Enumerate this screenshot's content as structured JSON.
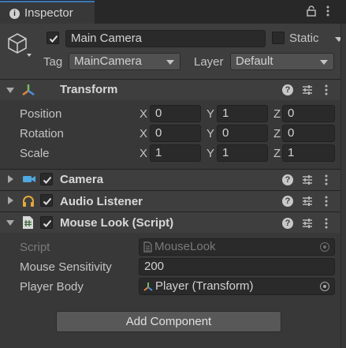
{
  "tab": {
    "label": "Inspector"
  },
  "gameobject": {
    "name": "Main Camera",
    "static_label": "Static",
    "tag_label": "Tag",
    "tag_value": "MainCamera",
    "layer_label": "Layer",
    "layer_value": "Default"
  },
  "transform": {
    "title": "Transform",
    "rows": [
      {
        "label": "Position",
        "x": "0",
        "y": "1",
        "z": "0"
      },
      {
        "label": "Rotation",
        "x": "0",
        "y": "0",
        "z": "0"
      },
      {
        "label": "Scale",
        "x": "1",
        "y": "1",
        "z": "1"
      }
    ],
    "axis": {
      "x": "X",
      "y": "Y",
      "z": "Z"
    }
  },
  "camera": {
    "title": "Camera"
  },
  "audio_listener": {
    "title": "Audio Listener"
  },
  "mouse_look": {
    "title": "Mouse Look (Script)",
    "script_label": "Script",
    "script_value": "MouseLook",
    "sensitivity_label": "Mouse Sensitivity",
    "sensitivity_value": "200",
    "player_body_label": "Player Body",
    "player_body_value": "Player (Transform)"
  },
  "add_component_label": "Add Component",
  "colors": {
    "accent": "#3a79bb",
    "panel": "#383838",
    "header": "#3e3e3e",
    "field": "#2a2a2a"
  }
}
